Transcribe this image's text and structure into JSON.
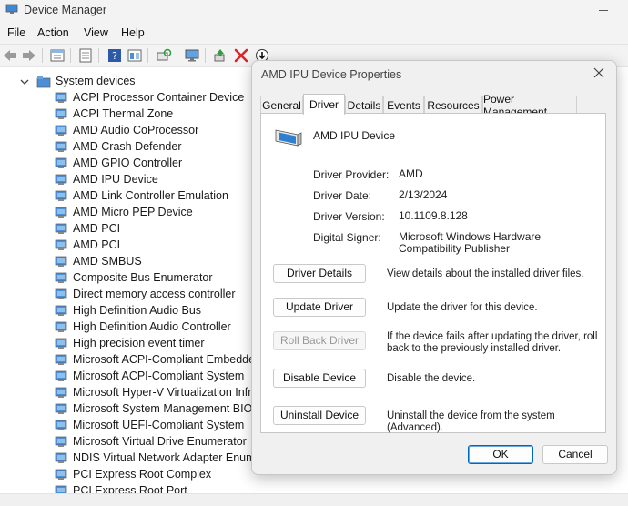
{
  "window": {
    "title": "Device Manager"
  },
  "menu": [
    "File",
    "Action",
    "View",
    "Help"
  ],
  "toolbar": {
    "icons": [
      "back-arrow-icon",
      "forward-arrow-icon",
      "properties-icon",
      "update-list-icon",
      "help-icon",
      "show-hidden-icon",
      "scan-hardware-icon",
      "monitor-icon",
      "add-driver-icon",
      "remove-device-icon",
      "download-icon"
    ]
  },
  "tree": {
    "root": "System devices",
    "items": [
      "ACPI Processor Container Device",
      "ACPI Thermal Zone",
      "AMD Audio CoProcessor",
      "AMD Crash Defender",
      "AMD GPIO Controller",
      "AMD IPU Device",
      "AMD Link Controller Emulation",
      "AMD Micro PEP Device",
      "AMD PCI",
      "AMD PCI",
      "AMD SMBUS",
      "Composite Bus Enumerator",
      "Direct memory access controller",
      "High Definition Audio Bus",
      "High Definition Audio Controller",
      "High precision event timer",
      "Microsoft ACPI-Compliant Embedded",
      "Microsoft ACPI-Compliant System",
      "Microsoft Hyper-V Virtualization Infra",
      "Microsoft System Management BIOS",
      "Microsoft UEFI-Compliant System",
      "Microsoft Virtual Drive Enumerator",
      "NDIS Virtual Network Adapter Enume",
      "PCI Express Root Complex",
      "PCI Express Root Port"
    ]
  },
  "dialog": {
    "title": "AMD IPU Device Properties",
    "tabs": [
      "General",
      "Driver",
      "Details",
      "Events",
      "Resources",
      "Power Management"
    ],
    "active_tab": "Driver",
    "device_name": "AMD IPU Device",
    "info": {
      "provider_label": "Driver Provider:",
      "provider_value": "AMD",
      "date_label": "Driver Date:",
      "date_value": "2/13/2024",
      "version_label": "Driver Version:",
      "version_value": "10.1109.8.128",
      "signer_label": "Digital Signer:",
      "signer_value": "Microsoft Windows Hardware Compatibility Publisher"
    },
    "actions": {
      "details_label": "Driver Details",
      "details_desc": "View details about the installed driver files.",
      "update_label": "Update Driver",
      "update_desc": "Update the driver for this device.",
      "rollback_label": "Roll Back Driver",
      "rollback_desc": "If the device fails after updating the driver, roll back to the previously installed driver.",
      "disable_label": "Disable Device",
      "disable_desc": "Disable the device.",
      "uninstall_label": "Uninstall Device",
      "uninstall_desc": "Uninstall the device from the system (Advanced)."
    },
    "ok_label": "OK",
    "cancel_label": "Cancel"
  },
  "colors": {
    "accent": "#0067c0",
    "device_icon": "#2f7fd0",
    "remove_red": "#d9262a",
    "add_green": "#2e9e3b"
  }
}
